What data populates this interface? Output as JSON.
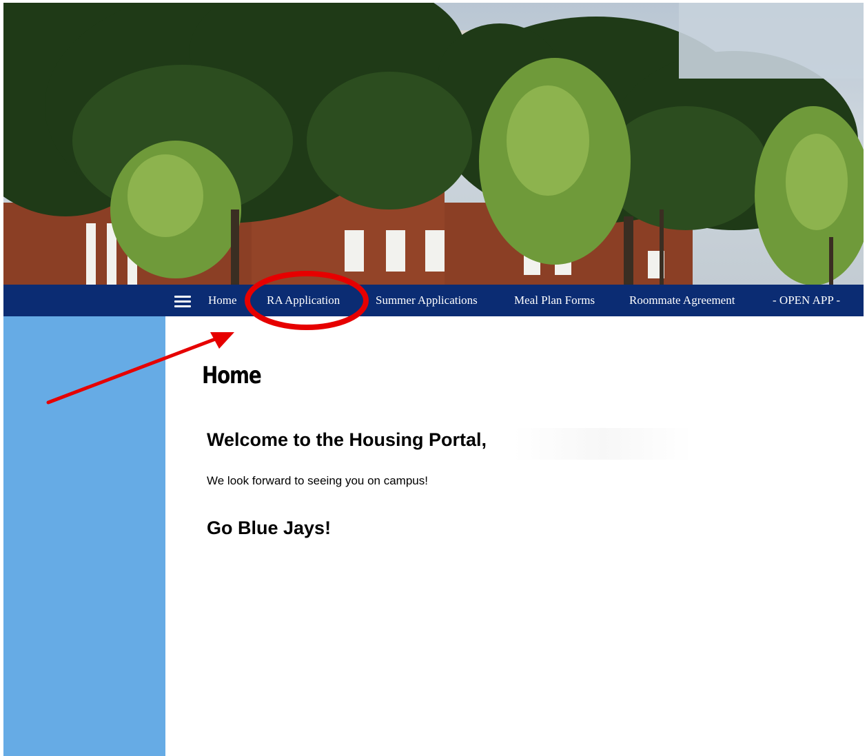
{
  "nav": {
    "menu_icon": "hamburger-menu-icon",
    "items": [
      {
        "label": "Home"
      },
      {
        "label": "RA Application"
      },
      {
        "label": "Summer Applications"
      },
      {
        "label": "Meal Plan Forms"
      },
      {
        "label": "Roommate Agreement"
      },
      {
        "label": "- OPEN APP -"
      }
    ]
  },
  "main": {
    "page_title": "Home",
    "welcome_heading": "Welcome to the Housing Portal,",
    "welcome_text": "We look forward to seeing you on campus!",
    "closing_heading": "Go Blue Jays!"
  },
  "colors": {
    "nav_background": "#0b2c73",
    "sidebar_background": "#66abe5",
    "annotation_red": "#e60000"
  }
}
